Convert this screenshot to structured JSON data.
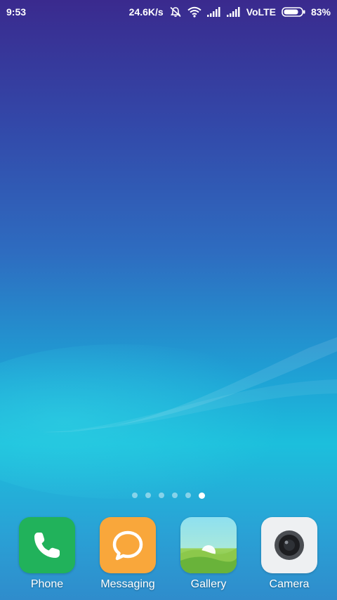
{
  "status_bar": {
    "time": "9:53",
    "network_speed": "24.6K/s",
    "volte": "VoLTE",
    "battery_percent": "83%",
    "icons": [
      "do-not-disturb-icon",
      "wifi-icon",
      "signal-sim1-icon",
      "signal-sim2-icon",
      "battery-icon"
    ]
  },
  "home": {
    "page_count": 6,
    "active_page": 6
  },
  "dock": {
    "apps": [
      {
        "label": "Phone",
        "icon": "phone-icon"
      },
      {
        "label": "Messaging",
        "icon": "messaging-icon"
      },
      {
        "label": "Gallery",
        "icon": "gallery-icon"
      },
      {
        "label": "Camera",
        "icon": "camera-icon"
      }
    ]
  },
  "colors": {
    "wallpaper_top": "#3a2a8e",
    "wallpaper_mid": "#1cbfdc",
    "phone": "#21b25b",
    "messaging": "#f9a73b",
    "camera": "#eef0f2"
  }
}
